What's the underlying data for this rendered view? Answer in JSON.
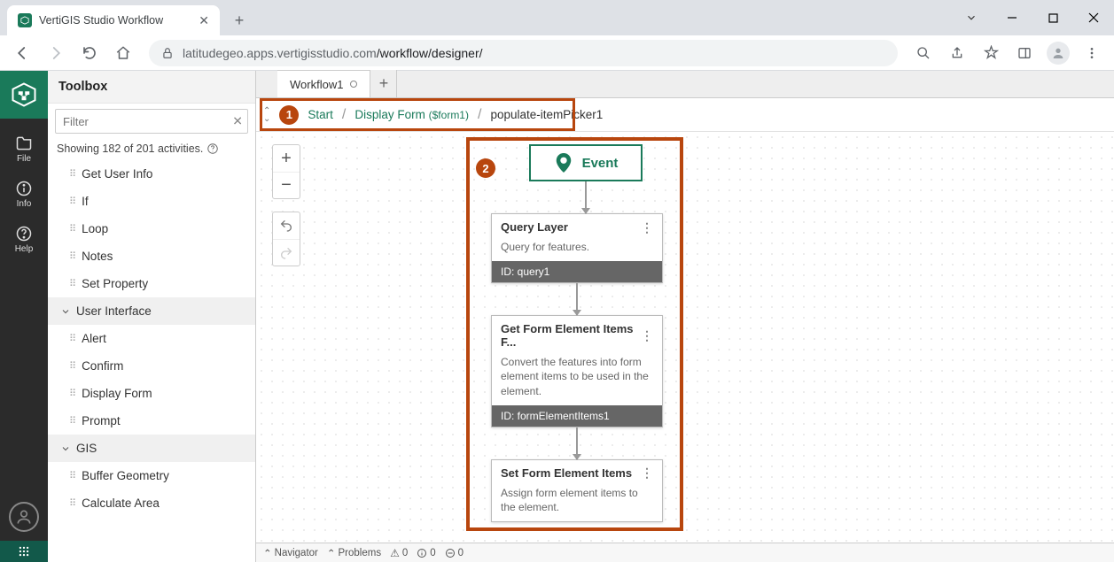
{
  "browser": {
    "tab_title": "VertiGIS Studio Workflow",
    "url_domain": "latitudegeo.apps.vertigisstudio.com",
    "url_path": "/workflow/designer/"
  },
  "rail": {
    "file": "File",
    "info": "Info",
    "help": "Help"
  },
  "toolbox": {
    "title": "Toolbox",
    "filter_placeholder": "Filter",
    "showing": "Showing 182 of 201 activities.",
    "items": [
      {
        "label": "Get User Info",
        "type": "item"
      },
      {
        "label": "If",
        "type": "item"
      },
      {
        "label": "Loop",
        "type": "item"
      },
      {
        "label": "Notes",
        "type": "item"
      },
      {
        "label": "Set Property",
        "type": "item"
      },
      {
        "label": "User Interface",
        "type": "section"
      },
      {
        "label": "Alert",
        "type": "item"
      },
      {
        "label": "Confirm",
        "type": "item"
      },
      {
        "label": "Display Form",
        "type": "item"
      },
      {
        "label": "Prompt",
        "type": "item"
      },
      {
        "label": "GIS",
        "type": "section"
      },
      {
        "label": "Buffer Geometry",
        "type": "item"
      },
      {
        "label": "Calculate Area",
        "type": "item"
      }
    ]
  },
  "doc_tab": "Workflow1",
  "breadcrumb": {
    "start": "Start",
    "display_form": "Display Form",
    "display_form_sub": "($form1)",
    "current": "populate-itemPicker1",
    "badge1": "1"
  },
  "canvas": {
    "badge2": "2",
    "event_label": "Event",
    "nodes": [
      {
        "title": "Query Layer",
        "desc": "Query for features.",
        "id": "ID: query1"
      },
      {
        "title": "Get Form Element Items F...",
        "desc": "Convert the features into form element items to be used in the element.",
        "id": "ID: formElementItems1"
      },
      {
        "title": "Set Form Element Items",
        "desc": "Assign form element items to the element.",
        "id": ""
      }
    ]
  },
  "status": {
    "navigator": "Navigator",
    "problems": "Problems",
    "warn": "0",
    "info": "0",
    "other": "0"
  }
}
